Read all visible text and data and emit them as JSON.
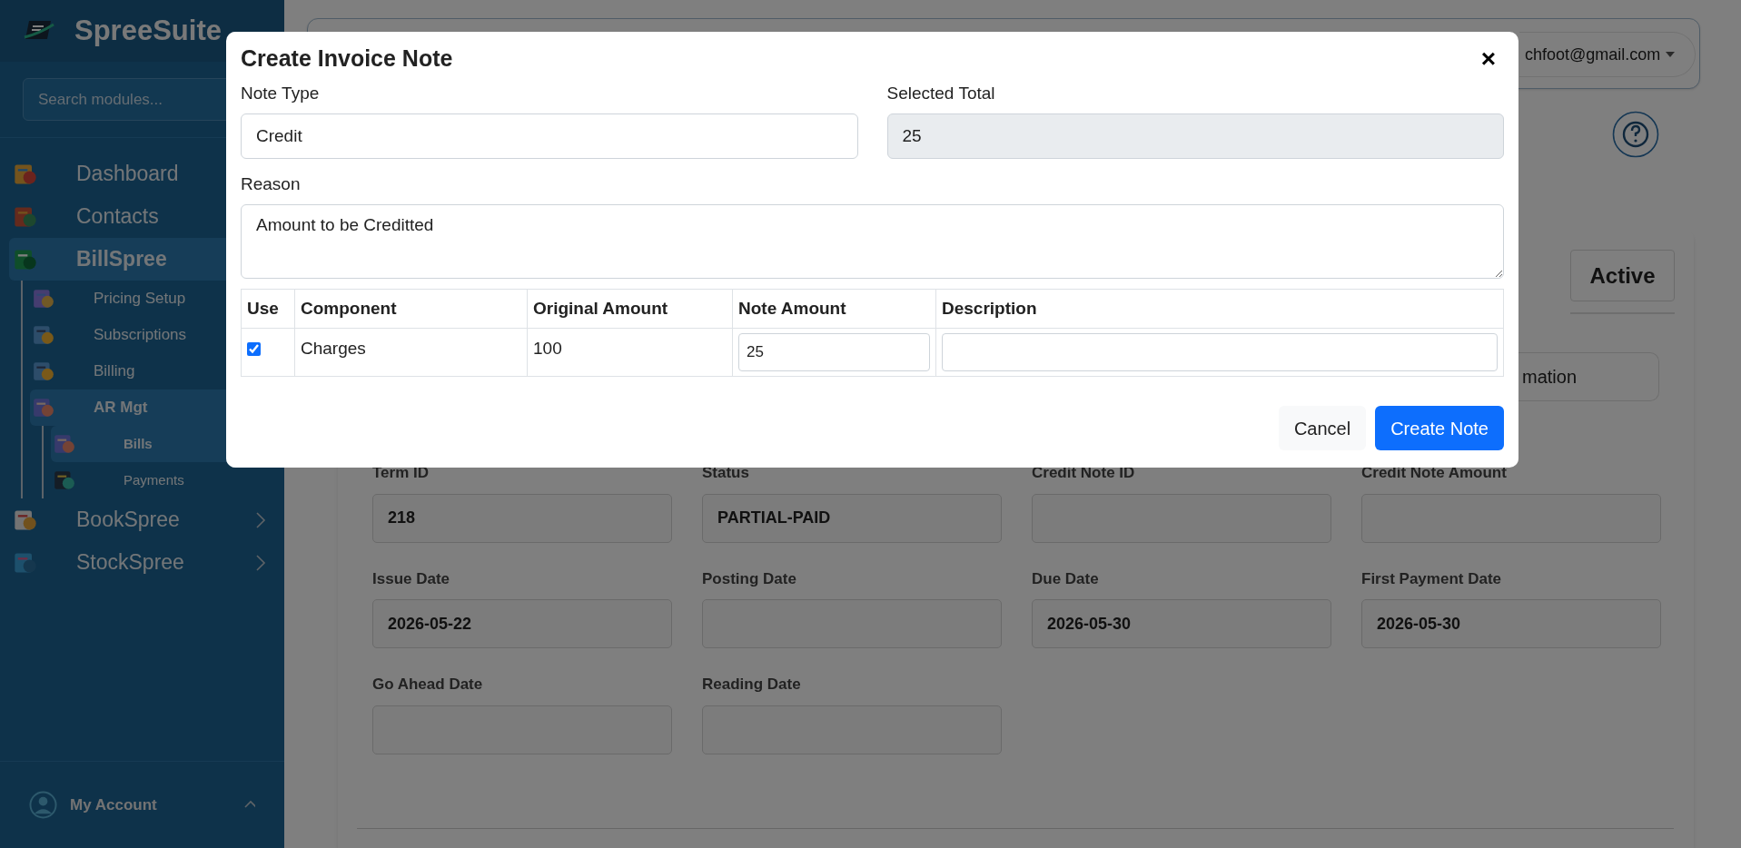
{
  "sidebar": {
    "brand": "SpreeSuite",
    "search": {
      "placeholder": "Search modules..."
    },
    "items": [
      {
        "label": "Dashboard",
        "selected": false
      },
      {
        "label": "Contacts",
        "selected": false
      },
      {
        "label": "BillSpree",
        "selected": true,
        "expanded": true,
        "children": [
          {
            "label": "Pricing Setup",
            "selected": false
          },
          {
            "label": "Subscriptions",
            "selected": false
          },
          {
            "label": "Billing",
            "selected": false
          },
          {
            "label": "AR Mgt",
            "selected": true,
            "expanded": true,
            "children": [
              {
                "label": "Bills",
                "selected": true
              },
              {
                "label": "Payments",
                "selected": false
              }
            ]
          }
        ]
      },
      {
        "label": "BookSpree",
        "selected": false,
        "expanded": false
      },
      {
        "label": "StockSpree",
        "selected": false,
        "expanded": false
      }
    ],
    "account": {
      "label": "My Account"
    }
  },
  "header": {
    "user_email": "chfoot@gmail.com"
  },
  "page": {
    "status_badge": "Active",
    "info_tab": "mation",
    "fields": [
      {
        "label": "Term ID",
        "value": "218"
      },
      {
        "label": "Status",
        "value": "PARTIAL-PAID"
      },
      {
        "label": "Credit Note ID"
      },
      {
        "label": "Credit Note Amount"
      },
      {
        "label": "Issue Date",
        "value": "2026-05-22"
      },
      {
        "label": "Posting Date"
      },
      {
        "label": "Due Date",
        "value": "2026-05-30"
      },
      {
        "label": "First Payment Date",
        "value": "2026-05-30"
      },
      {
        "label": "Go Ahead Date"
      },
      {
        "label": "Reading Date"
      }
    ]
  },
  "modal": {
    "title": "Create Invoice Note",
    "close": "×",
    "note_type": {
      "label": "Note Type",
      "value": "Credit"
    },
    "selected_total": {
      "label": "Selected Total",
      "value": "25"
    },
    "reason": {
      "label": "Reason",
      "value": "Amount to be Creditted"
    },
    "table": {
      "columns": [
        "Use",
        "Component",
        "Original Amount",
        "Note Amount",
        "Description"
      ],
      "rows": [
        {
          "use": true,
          "component": "Charges",
          "original_amount": "100",
          "note_amount": "25"
        }
      ]
    },
    "buttons": [
      {
        "label": "Cancel",
        "kind": "secondary"
      },
      {
        "label": "Create Note",
        "kind": "primary"
      }
    ]
  }
}
